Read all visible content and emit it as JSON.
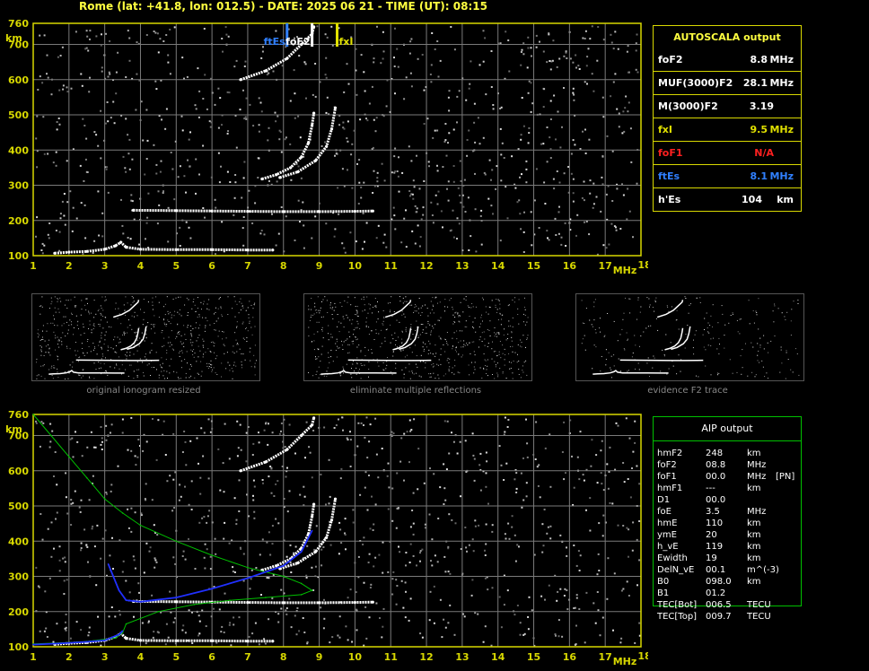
{
  "header": {
    "title": "Rome (lat: +41.8, lon: 012.5) - DATE: 2025 06 21 - TIME (UT): 08:15"
  },
  "colors": {
    "axis": "#d8d800",
    "grid": "#7a7a7a",
    "trace": "#ffffff",
    "profile": "#00c000",
    "aip_trace": "#2030ff",
    "fte_marker": "#3080ff",
    "fof2_marker": "#ffffff",
    "fxi_marker": "#e0e000"
  },
  "chart_data": [
    {
      "type": "scatter",
      "title": "",
      "xlabel": "MHz",
      "ylabel": "km",
      "xlim": [
        1,
        18
      ],
      "ylim": [
        100,
        760
      ],
      "x_ticks": [
        1,
        2,
        3,
        4,
        5,
        6,
        7,
        8,
        9,
        10,
        11,
        12,
        13,
        14,
        15,
        16,
        17,
        18
      ],
      "y_ticks": [
        100,
        200,
        300,
        400,
        500,
        600,
        700,
        760
      ],
      "grid": true,
      "markers": [
        {
          "name": "ftEs",
          "x": 8.1
        },
        {
          "name": "foF2",
          "x": 8.8
        },
        {
          "name": "fxI",
          "x": 9.5
        }
      ],
      "series": [
        {
          "values": [
            [
              1.6,
              107
            ],
            [
              2.0,
              110
            ],
            [
              2.5,
              112
            ],
            [
              3.0,
              118
            ],
            [
              3.3,
              128
            ],
            [
              3.45,
              138
            ],
            [
              3.6,
              124
            ],
            [
              4.0,
              118
            ],
            [
              5.0,
              117
            ],
            [
              6.0,
              117
            ],
            [
              7.0,
              116
            ],
            [
              7.7,
              116
            ]
          ]
        },
        {
          "values": [
            [
              3.8,
              229
            ],
            [
              5.0,
              228
            ],
            [
              6.0,
              227
            ],
            [
              7.0,
              226
            ],
            [
              8.0,
              225
            ],
            [
              9.0,
              225
            ],
            [
              10.0,
              226
            ],
            [
              10.5,
              227
            ]
          ]
        },
        {
          "values": [
            [
              7.4,
              318
            ],
            [
              7.8,
              330
            ],
            [
              8.2,
              350
            ],
            [
              8.5,
              380
            ],
            [
              8.7,
              420
            ],
            [
              8.8,
              470
            ],
            [
              8.85,
              505
            ]
          ]
        },
        {
          "values": [
            [
              7.9,
              322
            ],
            [
              8.4,
              338
            ],
            [
              8.9,
              370
            ],
            [
              9.2,
              410
            ],
            [
              9.35,
              460
            ],
            [
              9.45,
              520
            ]
          ]
        },
        {
          "values": [
            [
              6.8,
              600
            ],
            [
              7.5,
              625
            ],
            [
              8.1,
              660
            ],
            [
              8.5,
              700
            ],
            [
              8.8,
              730
            ],
            [
              8.85,
              750
            ]
          ]
        }
      ]
    },
    {
      "type": "scatter",
      "title": "",
      "xlabel": "MHz",
      "ylabel": "km",
      "xlim": [
        1,
        18
      ],
      "ylim": [
        100,
        760
      ],
      "x_ticks": [
        1,
        2,
        3,
        4,
        5,
        6,
        7,
        8,
        9,
        10,
        11,
        12,
        13,
        14,
        15,
        16,
        17,
        18
      ],
      "y_ticks": [
        100,
        200,
        300,
        400,
        500,
        600,
        700,
        760
      ],
      "grid": true,
      "series": [
        {
          "values": [
            [
              1.6,
              107
            ],
            [
              2.0,
              110
            ],
            [
              2.5,
              112
            ],
            [
              3.0,
              118
            ],
            [
              3.3,
              128
            ],
            [
              3.45,
              138
            ],
            [
              3.6,
              124
            ],
            [
              4.0,
              118
            ],
            [
              5.0,
              117
            ],
            [
              6.0,
              117
            ],
            [
              7.0,
              116
            ],
            [
              7.7,
              116
            ]
          ]
        },
        {
          "values": [
            [
              3.8,
              229
            ],
            [
              5.0,
              228
            ],
            [
              6.0,
              227
            ],
            [
              7.0,
              226
            ],
            [
              8.0,
              225
            ],
            [
              9.0,
              225
            ],
            [
              10.0,
              226
            ],
            [
              10.5,
              227
            ]
          ]
        },
        {
          "values": [
            [
              7.4,
              318
            ],
            [
              7.8,
              330
            ],
            [
              8.2,
              350
            ],
            [
              8.5,
              380
            ],
            [
              8.7,
              420
            ],
            [
              8.8,
              470
            ],
            [
              8.85,
              505
            ]
          ]
        },
        {
          "values": [
            [
              7.9,
              322
            ],
            [
              8.4,
              338
            ],
            [
              8.9,
              370
            ],
            [
              9.2,
              410
            ],
            [
              9.35,
              460
            ],
            [
              9.45,
              520
            ]
          ]
        },
        {
          "values": [
            [
              6.8,
              600
            ],
            [
              7.5,
              625
            ],
            [
              8.1,
              660
            ],
            [
              8.5,
              700
            ],
            [
              8.8,
              730
            ],
            [
              8.85,
              750
            ]
          ]
        },
        {
          "values": [
            [
              1.0,
              760
            ],
            [
              1.5,
              700
            ],
            [
              2.0,
              640
            ],
            [
              2.5,
              580
            ],
            [
              3.0,
              520
            ],
            [
              3.5,
              480
            ],
            [
              4.0,
              445
            ],
            [
              5.0,
              400
            ],
            [
              6.0,
              360
            ],
            [
              7.0,
              325
            ],
            [
              8.0,
              300
            ],
            [
              8.5,
              280
            ],
            [
              8.8,
              260
            ],
            [
              8.5,
              248
            ],
            [
              7.5,
              240
            ],
            [
              6.5,
              232
            ],
            [
              5.5,
              220
            ],
            [
              4.5,
              200
            ],
            [
              3.6,
              165
            ],
            [
              3.5,
              140
            ],
            [
              3.3,
              125
            ],
            [
              2.5,
              115
            ],
            [
              2.0,
              112
            ],
            [
              1.0,
              108
            ]
          ]
        },
        {
          "values": [
            [
              3.1,
              335
            ],
            [
              3.4,
              260
            ],
            [
              3.6,
              232
            ],
            [
              4.0,
              228
            ],
            [
              5.0,
              240
            ],
            [
              6.0,
              265
            ],
            [
              7.0,
              295
            ],
            [
              8.0,
              330
            ],
            [
              8.5,
              370
            ],
            [
              8.8,
              430
            ]
          ]
        },
        {
          "values": [
            [
              1.0,
              106
            ],
            [
              1.8,
              110
            ],
            [
              2.5,
              114
            ],
            [
              3.0,
              118
            ],
            [
              3.4,
              135
            ],
            [
              3.5,
              145
            ]
          ]
        }
      ]
    }
  ],
  "autoscala": {
    "title": "AUTOSCALA output",
    "rows": [
      {
        "label": "foF2",
        "value": "8.8",
        "unit": "MHz",
        "color": "#ffffff"
      },
      {
        "label": "MUF(3000)F2",
        "value": "28.1",
        "unit": "MHz",
        "color": "#ffffff"
      },
      {
        "label": "M(3000)F2",
        "value": "3.19",
        "unit": "",
        "color": "#ffffff"
      },
      {
        "label": "fxI",
        "value": "9.5",
        "unit": "MHz",
        "color": "#e0e000"
      },
      {
        "label": "foF1",
        "value": "N/A",
        "unit": "",
        "color": "#ff2020"
      },
      {
        "label": "ftEs",
        "value": "8.1",
        "unit": "MHz",
        "color": "#3080ff"
      },
      {
        "label": "h'Es",
        "value": "104",
        "unit": "km",
        "color": "#ffffff"
      }
    ]
  },
  "thumbnails": [
    {
      "caption": "original ionogram resized"
    },
    {
      "caption": "eliminate multiple reflections"
    },
    {
      "caption": "evidence F2 trace"
    }
  ],
  "aip": {
    "title": "AIP output",
    "rows": [
      {
        "label": "hmF2",
        "value": "248",
        "unit": "km",
        "flag": ""
      },
      {
        "label": "foF2",
        "value": "08.8",
        "unit": "MHz",
        "flag": ""
      },
      {
        "label": "foF1",
        "value": "00.0",
        "unit": "MHz",
        "flag": "[PN]"
      },
      {
        "label": "hmF1",
        "value": "---",
        "unit": "km",
        "flag": ""
      },
      {
        "label": "D1",
        "value": "00.0",
        "unit": "",
        "flag": ""
      },
      {
        "label": "foE",
        "value": "3.5",
        "unit": "MHz",
        "flag": ""
      },
      {
        "label": "hmE",
        "value": "110",
        "unit": "km",
        "flag": ""
      },
      {
        "label": "ymE",
        "value": "20",
        "unit": "km",
        "flag": ""
      },
      {
        "label": "h_vE",
        "value": "119",
        "unit": "km",
        "flag": ""
      },
      {
        "label": "Ewidth",
        "value": "19",
        "unit": "km",
        "flag": ""
      },
      {
        "label": "DelN_vE",
        "value": "00.1",
        "unit": "m^(-3)",
        "flag": ""
      },
      {
        "label": "B0",
        "value": "098.0",
        "unit": "km",
        "flag": ""
      },
      {
        "label": "B1",
        "value": "01.2",
        "unit": "",
        "flag": ""
      },
      {
        "label": "TEC[Bot]",
        "value": "006.5",
        "unit": "TECU",
        "flag": ""
      },
      {
        "label": "TEC[Top]",
        "value": "009.7",
        "unit": "TECU",
        "flag": ""
      }
    ]
  }
}
